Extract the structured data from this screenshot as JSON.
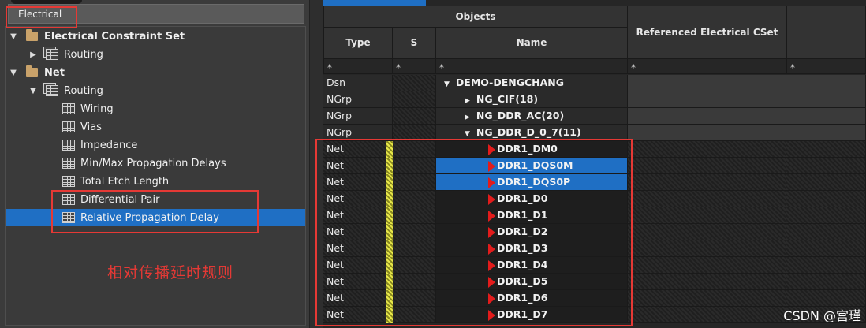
{
  "left_tab": "Electrical",
  "tree": [
    {
      "label": "Electrical Constraint Set",
      "level": 0,
      "arrow": "down",
      "icon": "folder",
      "bold": true
    },
    {
      "label": "Routing",
      "level": 1,
      "arrow": "right",
      "icon": "stack-grid",
      "bold": false
    },
    {
      "label": "Net",
      "level": 0,
      "arrow": "down",
      "icon": "folder",
      "bold": true
    },
    {
      "label": "Routing",
      "level": 1,
      "arrow": "down",
      "icon": "stack-grid",
      "bold": false
    },
    {
      "label": "Wiring",
      "level": 2,
      "arrow": "",
      "icon": "grid",
      "bold": false
    },
    {
      "label": "Vias",
      "level": 2,
      "arrow": "",
      "icon": "grid",
      "bold": false
    },
    {
      "label": "Impedance",
      "level": 2,
      "arrow": "",
      "icon": "grid",
      "bold": false
    },
    {
      "label": "Min/Max Propagation Delays",
      "level": 2,
      "arrow": "",
      "icon": "grid",
      "bold": false
    },
    {
      "label": "Total Etch Length",
      "level": 2,
      "arrow": "",
      "icon": "grid",
      "bold": false
    },
    {
      "label": "Differential Pair",
      "level": 2,
      "arrow": "",
      "icon": "grid",
      "bold": false
    },
    {
      "label": "Relative Propagation Delay",
      "level": 2,
      "arrow": "",
      "icon": "grid",
      "bold": false,
      "selected": true
    }
  ],
  "annotation_note": "相对传播延时规则",
  "headers": {
    "objects": "Objects",
    "type": "Type",
    "s": "S",
    "name": "Name",
    "ref": "Referenced Electrical CSet"
  },
  "filter": [
    "*",
    "*",
    "*",
    "*",
    "*"
  ],
  "rows": [
    {
      "type": "Dsn",
      "name": "DEMO-DENGCHANG",
      "depth": 0,
      "expander": "down",
      "flag": false,
      "ybar": false
    },
    {
      "type": "NGrp",
      "name": "NG_CIF(18)",
      "depth": 1,
      "expander": "right",
      "flag": false,
      "ybar": false
    },
    {
      "type": "NGrp",
      "name": "NG_DDR_AC(20)",
      "depth": 1,
      "expander": "right",
      "flag": false,
      "ybar": false
    },
    {
      "type": "NGrp",
      "name": "NG_DDR_D_0_7(11)",
      "depth": 1,
      "expander": "down",
      "flag": false,
      "ybar": false
    },
    {
      "type": "Net",
      "name": "DDR1_DM0",
      "depth": 2,
      "flag": true,
      "ybar": true
    },
    {
      "type": "Net",
      "name": "DDR1_DQS0M",
      "depth": 2,
      "flag": true,
      "ybar": true,
      "selected": true
    },
    {
      "type": "Net",
      "name": "DDR1_DQS0P",
      "depth": 2,
      "flag": true,
      "ybar": true,
      "selected": true
    },
    {
      "type": "Net",
      "name": "DDR1_D0",
      "depth": 2,
      "flag": true,
      "ybar": true
    },
    {
      "type": "Net",
      "name": "DDR1_D1",
      "depth": 2,
      "flag": true,
      "ybar": true
    },
    {
      "type": "Net",
      "name": "DDR1_D2",
      "depth": 2,
      "flag": true,
      "ybar": true
    },
    {
      "type": "Net",
      "name": "DDR1_D3",
      "depth": 2,
      "flag": true,
      "ybar": true
    },
    {
      "type": "Net",
      "name": "DDR1_D4",
      "depth": 2,
      "flag": true,
      "ybar": true
    },
    {
      "type": "Net",
      "name": "DDR1_D5",
      "depth": 2,
      "flag": true,
      "ybar": true
    },
    {
      "type": "Net",
      "name": "DDR1_D6",
      "depth": 2,
      "flag": true,
      "ybar": true
    },
    {
      "type": "Net",
      "name": "DDR1_D7",
      "depth": 2,
      "flag": true,
      "ybar": true
    }
  ],
  "watermark": "CSDN @宫瑾",
  "colors": {
    "selection": "#1f6fc4",
    "annotation": "#e53935",
    "flag": "#e31b1b",
    "marker": "#e8e84a"
  }
}
